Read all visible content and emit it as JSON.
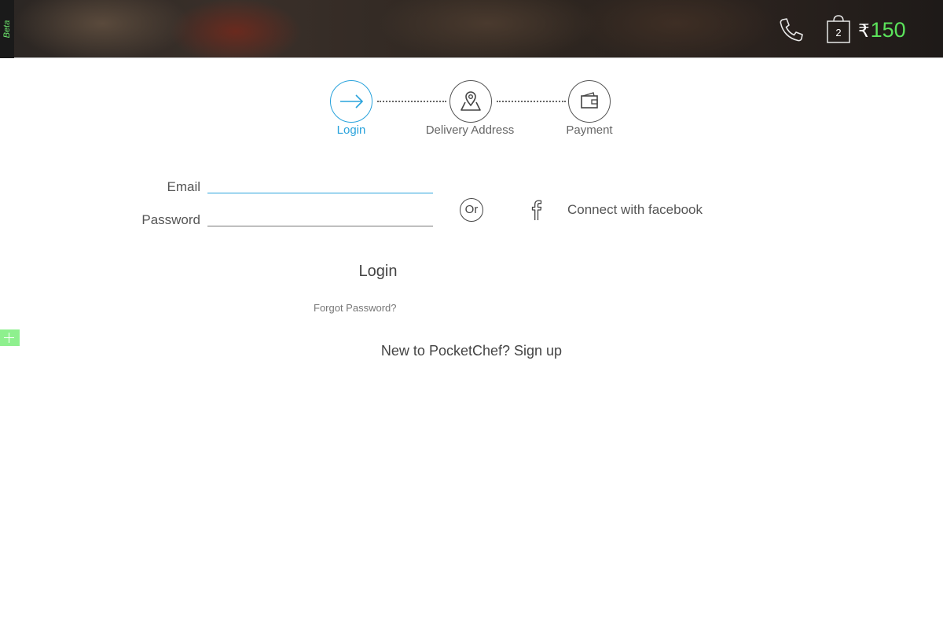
{
  "header": {
    "beta_label": "Beta",
    "cart_count": "2",
    "currency_symbol": "₹",
    "cart_total": "150",
    "icons": [
      "phone-icon",
      "shopping-bag-icon"
    ]
  },
  "steps": [
    {
      "label": "Login",
      "icon": "arrow-right-icon",
      "active": true
    },
    {
      "label": "Delivery Address",
      "icon": "map-pin-icon",
      "active": false
    },
    {
      "label": "Payment",
      "icon": "wallet-icon",
      "active": false
    }
  ],
  "form": {
    "email_label": "Email",
    "password_label": "Password",
    "email_value": "",
    "password_value": "",
    "or_label": "Or",
    "facebook_label": "Connect with facebook",
    "login_button": "Login",
    "forgot_password": "Forgot Password?",
    "signup_text": "New to PocketChef? Sign up"
  },
  "colors": {
    "accent": "#2aa3dc",
    "price_green": "#5be35b",
    "beta_green": "#6ee86e",
    "side_tab_green": "#8ef08e"
  }
}
